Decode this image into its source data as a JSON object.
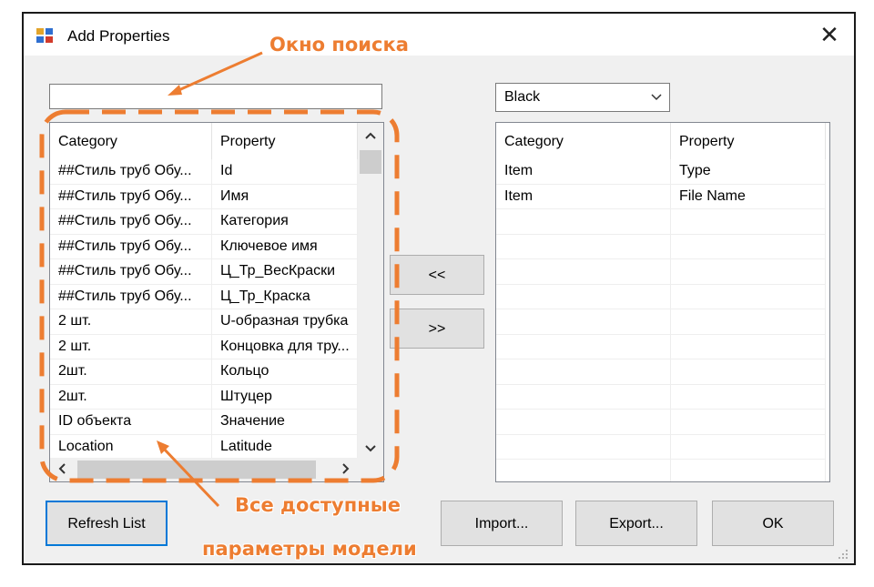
{
  "window": {
    "title": "Add Properties",
    "close_glyph": "✕"
  },
  "search": {
    "value": "",
    "placeholder": ""
  },
  "left_list": {
    "headers": [
      "Category",
      "Property"
    ],
    "rows": [
      [
        "##Стиль труб Обу...",
        "Id"
      ],
      [
        "##Стиль труб Обу...",
        "Имя"
      ],
      [
        "##Стиль труб Обу...",
        "Категория"
      ],
      [
        "##Стиль труб Обу...",
        "Ключевое имя"
      ],
      [
        "##Стиль труб Обу...",
        "Ц_Тр_ВесКраски"
      ],
      [
        "##Стиль труб Обу...",
        "Ц_Тр_Краска"
      ],
      [
        "2 шт.",
        "U-образная трубка"
      ],
      [
        "2 шт.",
        "Концовка для тру..."
      ],
      [
        "2шт.",
        "Кольцо"
      ],
      [
        "2шт.",
        "Штуцер"
      ],
      [
        "ID объекта",
        "Значение"
      ],
      [
        "Location",
        "Latitude"
      ]
    ]
  },
  "right_panel": {
    "dropdown": {
      "selected": "Black"
    },
    "headers": [
      "Category",
      "Property"
    ],
    "rows": [
      [
        "Item",
        "Type"
      ],
      [
        "Item",
        "File Name"
      ]
    ]
  },
  "buttons": {
    "remove": "<<",
    "add": ">>",
    "refresh": "Refresh List",
    "import": "Import...",
    "export": "Export...",
    "ok": "OK"
  },
  "annotations": {
    "search": "Окно поиска",
    "params_line1": "Все доступные",
    "params_line2": "параметры модели",
    "color": "#ed7d31"
  },
  "icons": [
    "app-icon",
    "close-icon",
    "chevron-down-icon",
    "scroll-up-icon",
    "scroll-down-icon",
    "scroll-left-icon",
    "scroll-right-icon",
    "resize-grip-icon"
  ]
}
